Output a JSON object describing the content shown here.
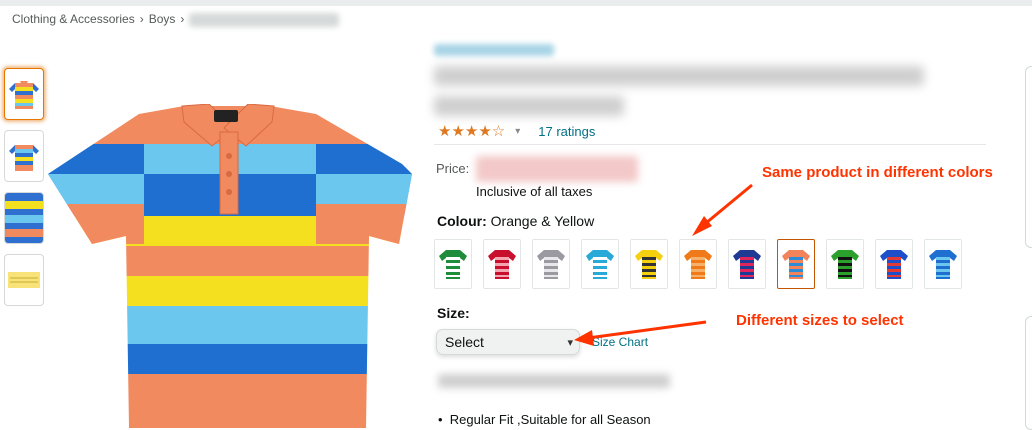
{
  "breadcrumb": {
    "items": [
      "Clothing & Accessories",
      "Boys"
    ],
    "separator": "›"
  },
  "product": {
    "rating": {
      "stars": "★★★★☆",
      "count_text": "17 ratings"
    },
    "price": {
      "label": "Price:",
      "tax_note": "Inclusive of all taxes"
    },
    "colour": {
      "label": "Colour:",
      "value": "Orange & Yellow"
    },
    "size": {
      "label": "Size:",
      "selected": "Select",
      "chart_link": "Size Chart"
    },
    "bullet": "Regular Fit ,Suitable for all Season"
  },
  "swatches": [
    {
      "stripes": [
        "#1e8c3a",
        "#ffffff"
      ]
    },
    {
      "stripes": [
        "#c8102e",
        "#f4a6b0"
      ]
    },
    {
      "stripes": [
        "#9a9aa0",
        "#e8e8ec"
      ]
    },
    {
      "stripes": [
        "#29a9d8",
        "#ffffff"
      ]
    },
    {
      "stripes": [
        "#f5d00f",
        "#333333"
      ]
    },
    {
      "stripes": [
        "#f07a1a",
        "#f5b06a"
      ]
    },
    {
      "stripes": [
        "#1f3a93",
        "#e0245e"
      ]
    },
    {
      "stripes": [
        "#f2835a",
        "#2e8bd6"
      ],
      "selected": true
    },
    {
      "stripes": [
        "#2ca02c",
        "#111111"
      ]
    },
    {
      "stripes": [
        "#1f4fc8",
        "#e53935"
      ]
    },
    {
      "stripes": [
        "#1f6fd0",
        "#6cc7ee"
      ]
    }
  ],
  "annotations": {
    "colors": "Same product in different colors",
    "sizes": "Different sizes to select"
  },
  "colors": {
    "accent_orange": "#de7921",
    "link_teal": "#007185",
    "annotation_red": "#ff3300"
  }
}
